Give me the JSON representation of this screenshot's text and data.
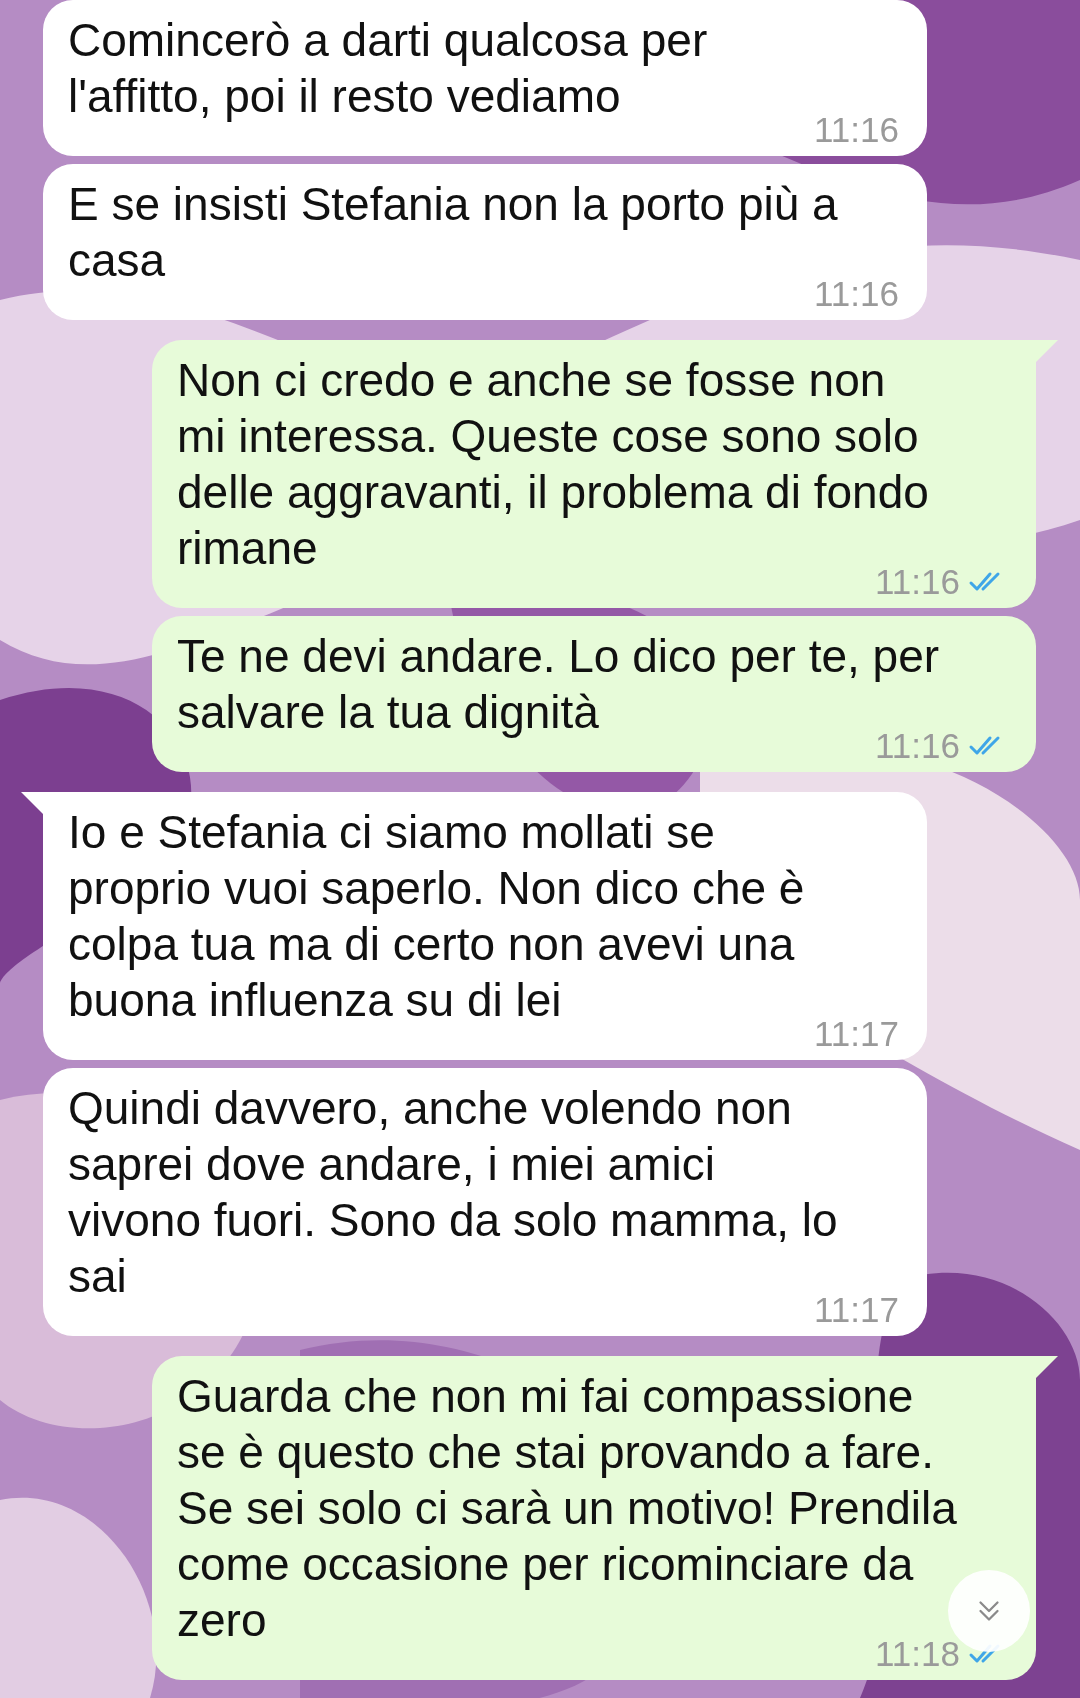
{
  "messages": [
    {
      "kind": "incoming",
      "lines": [
        "Comincerò a darti qualcosa per",
        "l'affitto, poi il resto vediamo"
      ],
      "time": "11:16"
    },
    {
      "kind": "incoming",
      "lines": [
        "E se insisti Stefania non la porto più a",
        "casa"
      ],
      "time": "11:16"
    },
    {
      "kind": "outgoing",
      "lines": [
        "Non ci credo e anche se fosse non",
        "mi interessa. Queste cose sono solo",
        "delle aggravanti, il problema di fondo",
        "rimane"
      ],
      "time": "11:16",
      "read": true
    },
    {
      "kind": "outgoing",
      "lines": [
        "Te ne devi andare. Lo dico per te, per",
        "salvare la tua dignità"
      ],
      "time": "11:16",
      "read": true
    },
    {
      "kind": "incoming",
      "lines": [
        "Io e Stefania ci siamo mollati se",
        "proprio vuoi saperlo. Non dico che è",
        "colpa tua ma di certo non avevi una",
        "buona influenza su di lei"
      ],
      "time": "11:17"
    },
    {
      "kind": "incoming",
      "lines": [
        "Quindi davvero, anche volendo non",
        "saprei dove andare, i miei amici",
        "vivono fuori. Sono da solo mamma, lo",
        "sai"
      ],
      "time": "11:17"
    },
    {
      "kind": "outgoing",
      "lines": [
        "Guarda che non mi fai compassione",
        "se è questo che stai provando a fare.",
        "Se sei solo ci sarà un motivo! Prendila",
        "come occasione per ricominciare da",
        "zero"
      ],
      "time": "11:18",
      "read": true
    }
  ]
}
